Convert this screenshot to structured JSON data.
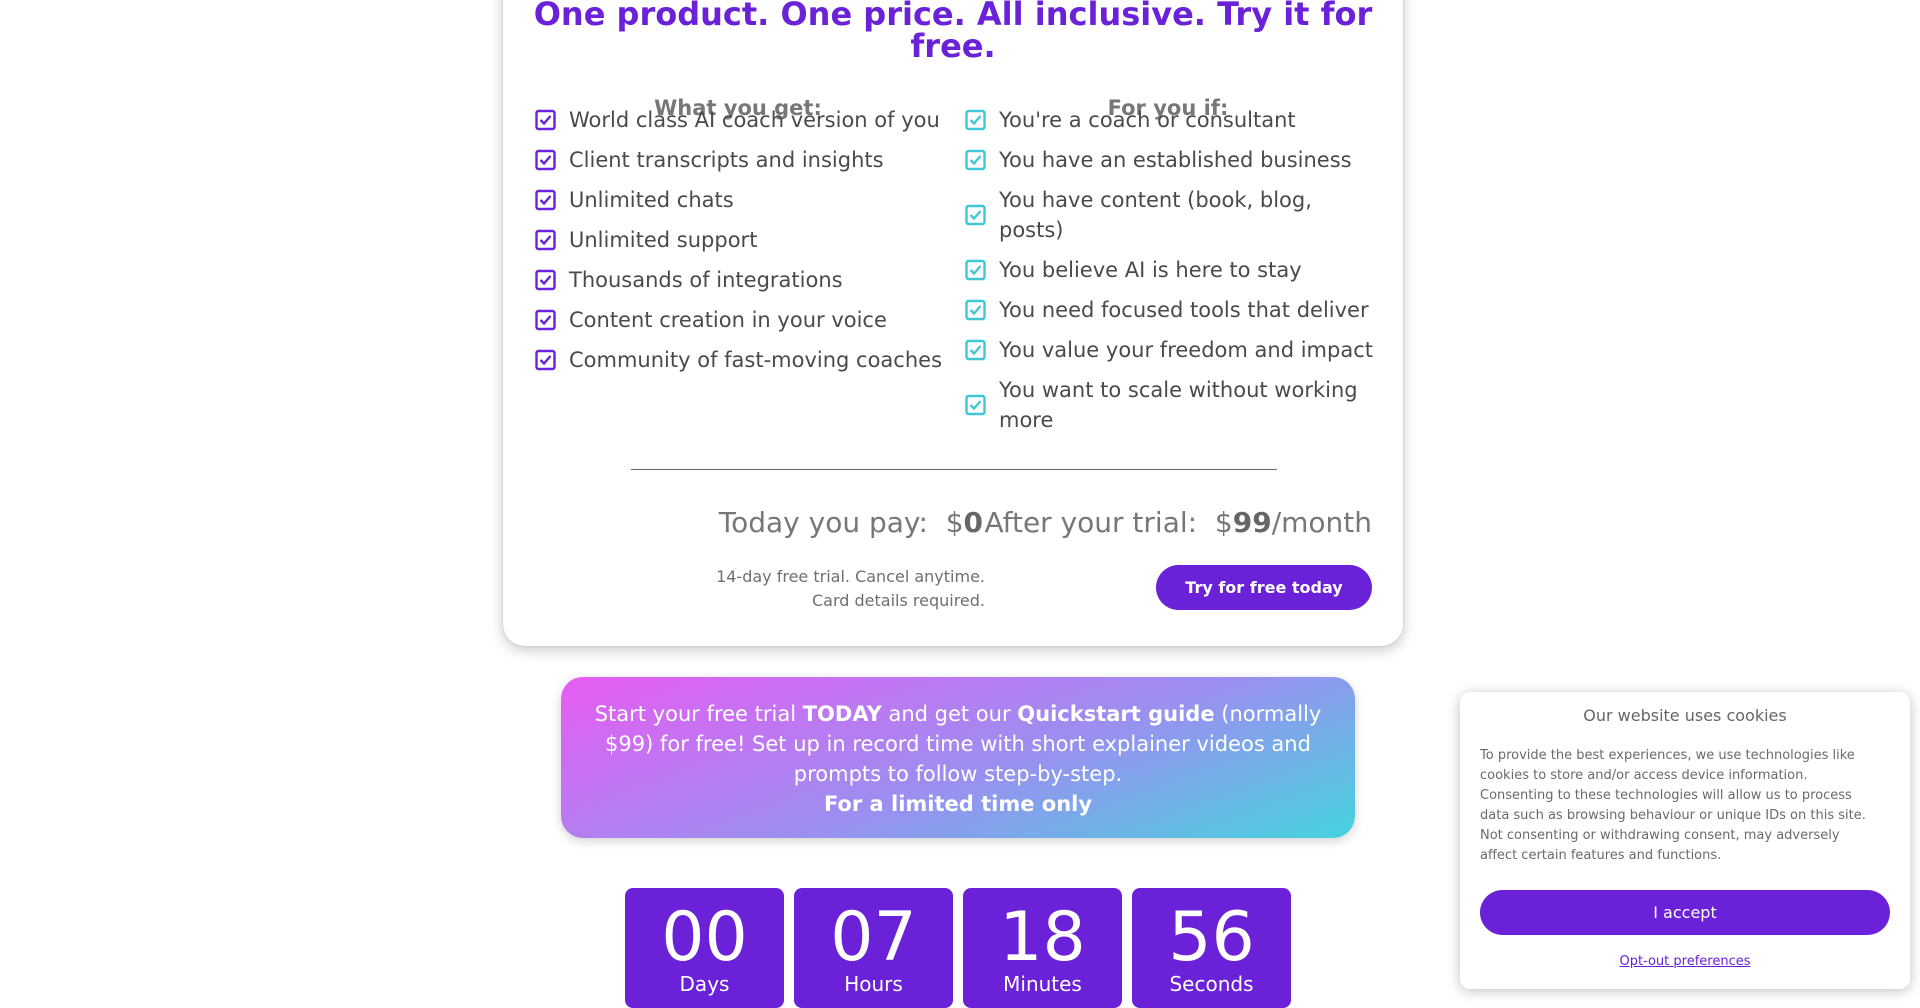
{
  "colors": {
    "accent": "#6a21d8",
    "teal_check": "#3fc7d3",
    "purple_check": "#6a21d8"
  },
  "pricing": {
    "headline": "One product. One price. All inclusive. Try it for free.",
    "left_heading": "What you get:",
    "right_heading": "For you if:",
    "features": [
      "World class AI coach version of you",
      "Client transcripts and insights",
      "Unlimited chats",
      "Unlimited support",
      "Thousands of integrations",
      "Content creation in your voice",
      "Community of fast-moving coaches"
    ],
    "fit": [
      "You're a coach or consultant",
      "You have an established business",
      "You have content (book, blog, posts)",
      "You believe AI is here to stay",
      "You need focused tools that deliver",
      "You value your freedom and impact",
      "You want to scale without working more"
    ],
    "today_label": "Today you pay:",
    "today_currency": "$",
    "today_amount": "0",
    "after_label": "After your trial:",
    "after_currency": "$",
    "after_amount": "99",
    "after_period": "/month",
    "note_line1": "14-day free trial. Cancel anytime.",
    "note_line2": "Card details required.",
    "cta_label": "Try for free today"
  },
  "promo": {
    "part1": "Start your free trial ",
    "bold1": "TODAY",
    "part2": " and get our ",
    "bold2": "Quickstart guide",
    "part3": " (normally $99) for free! Set up in record time with short explainer videos and prompts to follow step-by-step.",
    "limited": "For a limited time only"
  },
  "countdown": [
    {
      "value": "00",
      "label": "Days"
    },
    {
      "value": "07",
      "label": "Hours"
    },
    {
      "value": "18",
      "label": "Minutes"
    },
    {
      "value": "56",
      "label": "Seconds"
    }
  ],
  "cookie": {
    "title": "Our website uses cookies",
    "body": "To provide the best experiences, we use technologies like cookies to store and/or access device information. Consenting to these technologies will allow us to process data such as browsing behaviour or unique IDs on this site. Not consenting or withdrawing consent, may adversely affect certain features and functions.",
    "accept_label": "I accept",
    "optout_label": "Opt-out preferences"
  }
}
